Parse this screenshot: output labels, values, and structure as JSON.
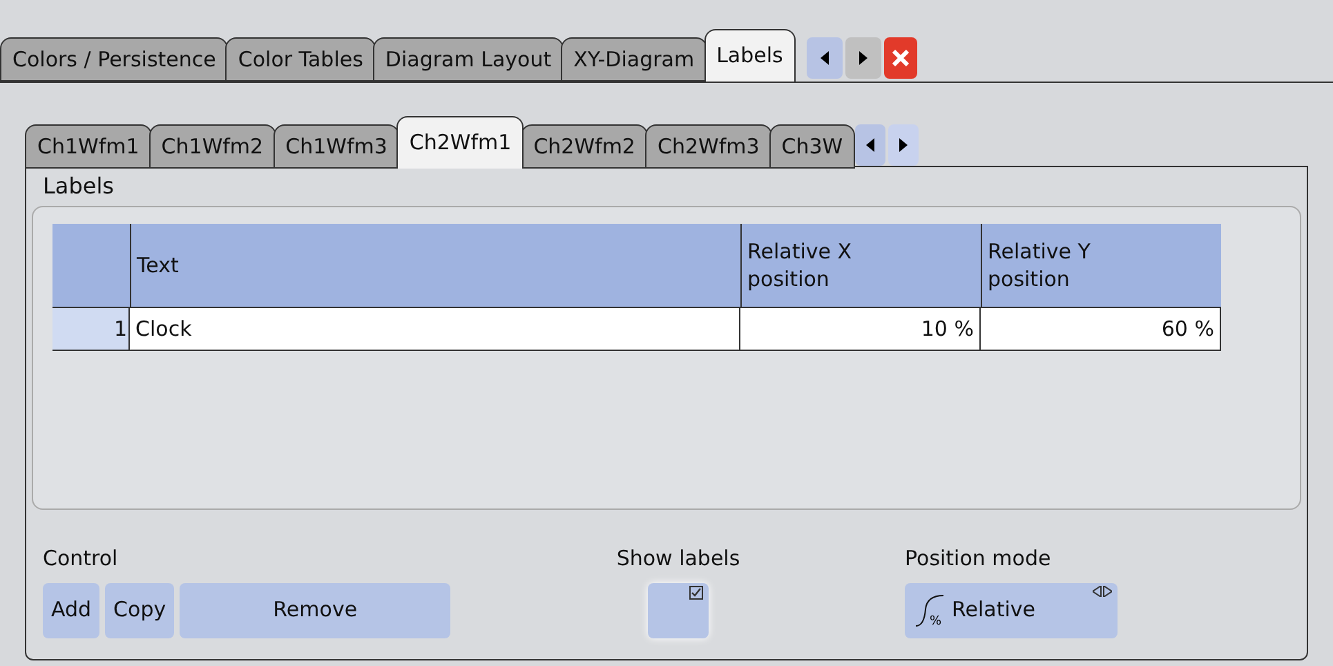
{
  "top_tabs": [
    {
      "label": "Colors / Persistence",
      "selected": false
    },
    {
      "label": "Color Tables",
      "selected": false
    },
    {
      "label": "Diagram Layout",
      "selected": false
    },
    {
      "label": "XY-Diagram",
      "selected": false
    },
    {
      "label": "Labels",
      "selected": true
    }
  ],
  "sub_tabs": [
    {
      "label": "Ch1Wfm1",
      "selected": false
    },
    {
      "label": "Ch1Wfm2",
      "selected": false
    },
    {
      "label": "Ch1Wfm3",
      "selected": false
    },
    {
      "label": "Ch2Wfm1",
      "selected": true
    },
    {
      "label": "Ch2Wfm2",
      "selected": false
    },
    {
      "label": "Ch2Wfm3",
      "selected": false
    },
    {
      "label": "Ch3W",
      "selected": false
    }
  ],
  "panel": {
    "title": "Labels",
    "table": {
      "columns": [
        "Text",
        "Relative X position",
        "Relative Y position"
      ],
      "rows": [
        {
          "index": "1",
          "cells": [
            "Clock",
            "10 %",
            "60 %"
          ]
        }
      ]
    },
    "control": {
      "label": "Control",
      "buttons": [
        "Add",
        "Copy",
        "Remove"
      ]
    },
    "show_labels": {
      "label": "Show labels",
      "on": true
    },
    "position_mode": {
      "label": "Position mode",
      "icon_text": "%",
      "value": "Relative"
    }
  }
}
